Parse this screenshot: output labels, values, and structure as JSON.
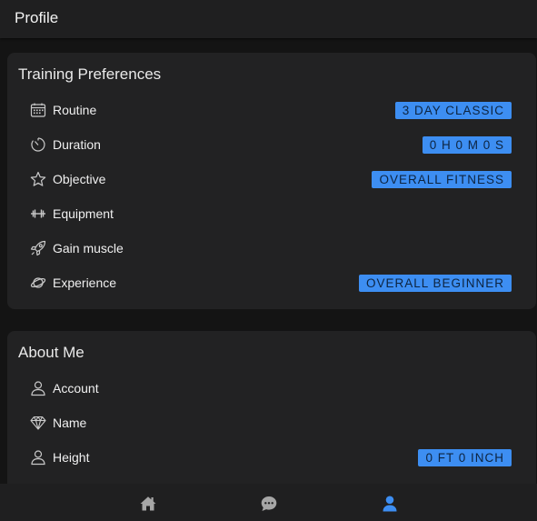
{
  "header": {
    "title": "Profile"
  },
  "training": {
    "title": "Training Preferences",
    "items": [
      {
        "icon": "calendar-icon",
        "label": "Routine",
        "value": "3 DAY CLASSIC"
      },
      {
        "icon": "timer-icon",
        "label": "Duration",
        "value": "0 H 0 M 0 S"
      },
      {
        "icon": "star-icon",
        "label": "Objective",
        "value": "OVERALL FITNESS"
      },
      {
        "icon": "dumbbell-icon",
        "label": "Equipment",
        "value": ""
      },
      {
        "icon": "rocket-icon",
        "label": "Gain muscle",
        "value": ""
      },
      {
        "icon": "planet-icon",
        "label": "Experience",
        "value": "OVERALL BEGINNER"
      }
    ]
  },
  "about": {
    "title": "About Me",
    "items": [
      {
        "icon": "user-icon",
        "label": "Account",
        "value": ""
      },
      {
        "icon": "diamond-icon",
        "label": "Name",
        "value": ""
      },
      {
        "icon": "user-icon",
        "label": "Height",
        "value": "0 FT 0 INCH"
      }
    ]
  },
  "tabs": [
    {
      "icon": "home-icon",
      "active": false
    },
    {
      "icon": "chat-icon",
      "active": false
    },
    {
      "icon": "person-icon",
      "active": true
    }
  ],
  "colors": {
    "accent": "#3d8ef2",
    "background": "#141414",
    "card": "#222223"
  }
}
